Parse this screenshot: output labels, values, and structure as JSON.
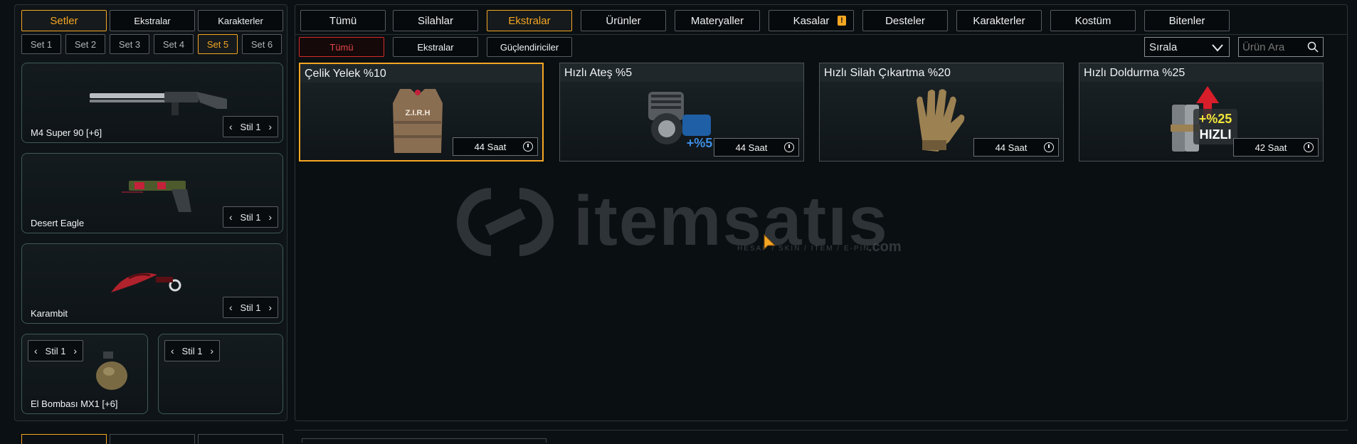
{
  "left": {
    "top_tabs": [
      "Setler",
      "Ekstralar",
      "Karakterler"
    ],
    "set_tabs": [
      "Set 1",
      "Set 2",
      "Set 3",
      "Set 4",
      "Set 5",
      "Set 6"
    ],
    "items": [
      {
        "name": "M4 Super 90 [+6]",
        "style": "Stil 1"
      },
      {
        "name": "Desert Eagle",
        "style": "Stil 1"
      },
      {
        "name": "Karambit",
        "style": "Stil 1"
      },
      {
        "name": "El Bombası MX1 [+6]",
        "style": "Stil 1"
      },
      {
        "name": "",
        "style": "Stil 1"
      }
    ]
  },
  "main": {
    "tabs": [
      "Tümü",
      "Silahlar",
      "Ekstralar",
      "Ürünler",
      "Materyaller",
      "Kasalar",
      "Desteler",
      "Karakterler",
      "Kostüm",
      "Bitenler"
    ],
    "active_tab": "Ekstralar",
    "sub_tabs": [
      "Tümü",
      "Ekstralar",
      "Güçlendiriciler"
    ],
    "sort_label": "Sırala",
    "search_placeholder": "Ürün Ara",
    "cards": [
      {
        "title": "Çelik Yelek %10",
        "time": "44 Saat",
        "badge": "Z.I.R.H"
      },
      {
        "title": "Hızlı Ateş %5",
        "time": "44 Saat",
        "badge": "+%5"
      },
      {
        "title": "Hızlı Silah Çıkartma %20",
        "time": "44 Saat",
        "badge": ""
      },
      {
        "title": "Hızlı Doldurma %25",
        "time": "42 Saat",
        "badge": "+%25 HIZLI"
      }
    ],
    "watermark": {
      "brand": "itemsatıs",
      "tagline": "HESAP / SKIN / ITEM / E-PIN",
      "domain": ".com"
    }
  },
  "colors": {
    "accent": "#f5a623",
    "danger": "#d62a2a",
    "background": "#0b1014"
  }
}
